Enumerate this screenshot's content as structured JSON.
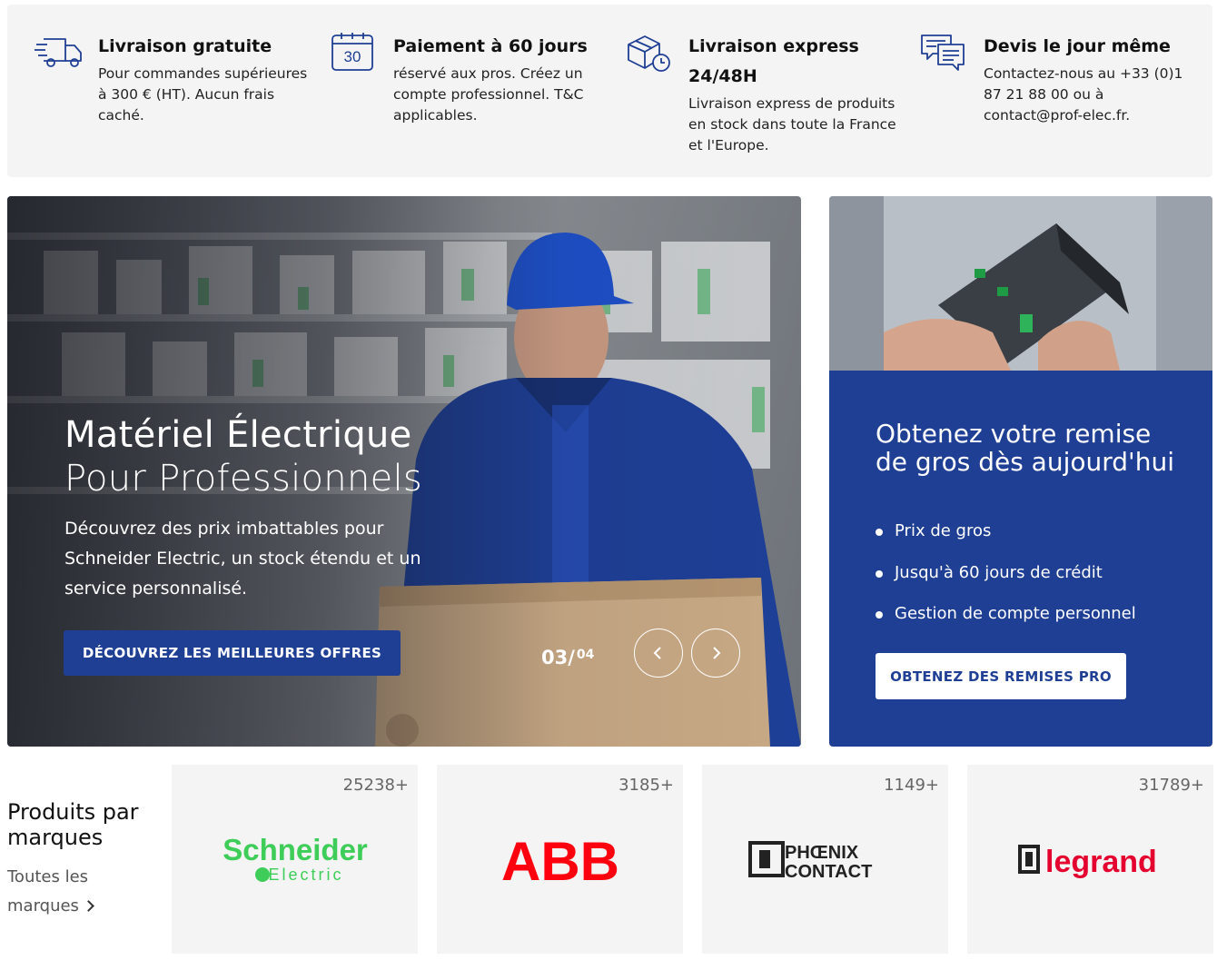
{
  "features": [
    {
      "icon": "truck-icon",
      "title": "Livraison gratuite",
      "text": "Pour commandes supérieures à 300 € (HT). Aucun frais caché."
    },
    {
      "icon": "calendar-icon",
      "icon_label": "30",
      "title": "Paiement à 60 jours",
      "text": "réservé aux pros. Créez un compte professionnel. T&C applicables."
    },
    {
      "icon": "box-clock-icon",
      "title": "Livraison express 24/48H",
      "text": "Livraison express de produits en stock dans toute la France et l'Europe."
    },
    {
      "icon": "chat-bubbles-icon",
      "title": "Devis le jour même",
      "text": "Contactez-nous au +33 (0)1 87 21 88 00 ou à contact@prof-elec.fr."
    }
  ],
  "hero": {
    "title_line1": "Matériel Électrique",
    "title_line2": "Pour Professionnels",
    "description": "Découvrez des prix imbattables pour Schneider Electric, un stock étendu et un service personnalisé.",
    "cta_label": "DÉCOUVREZ LES MEILLEURES OFFRES",
    "pager_current": "03/",
    "pager_total": "04"
  },
  "promo": {
    "title": "Obtenez votre remise de gros dès aujourd'hui",
    "bullets": [
      "Prix de gros",
      "Jusqu'à 60 jours de crédit",
      "Gestion de compte personnel"
    ],
    "button_label": "OBTENEZ DES REMISES PRO"
  },
  "brands": {
    "heading": "Produits par marques",
    "all_link": "Toutes les marques",
    "items": [
      {
        "name": "Schneider Electric",
        "logo_line1": "Schneider",
        "logo_line2": "Electric",
        "count": "25238+",
        "color": "#3dcd58"
      },
      {
        "name": "ABB",
        "logo_text": "ABB",
        "count": "3185+",
        "color": "#ff000f"
      },
      {
        "name": "Phoenix Contact",
        "logo_line1": "PHŒNIX",
        "logo_line2": "CONTACT",
        "count": "1149+",
        "color": "#222222"
      },
      {
        "name": "Legrand",
        "logo_text": "legrand",
        "count": "31789+",
        "color": "#e4032e"
      }
    ]
  },
  "colors": {
    "brand_blue": "#1f3f95",
    "panel_gray": "#f4f4f4"
  }
}
